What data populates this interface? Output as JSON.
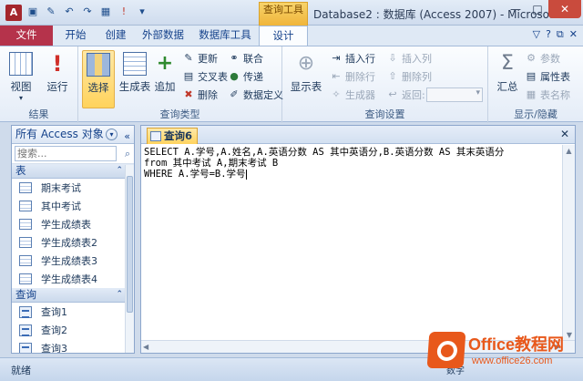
{
  "titlebar": {
    "app_icon_letter": "A",
    "qat_icons": [
      "save-icon",
      "edit-icon",
      "undo-icon",
      "redo-icon",
      "view-icon",
      "run-icon",
      "dropdown-icon"
    ],
    "context_group": "查询工具",
    "title": "Database2 : 数据库 (Access 2007) - Microsoft...",
    "controls": [
      "—",
      "□",
      "✕"
    ]
  },
  "tabs": {
    "file": "文件",
    "items": [
      "开始",
      "创建",
      "外部数据",
      "数据库工具"
    ],
    "active": "设计",
    "help_icons": [
      "▽",
      "?",
      "⧉",
      "✕"
    ]
  },
  "ribbon": {
    "results": {
      "label": "结果",
      "view": "视图",
      "run": "运行"
    },
    "query_type": {
      "label": "查询类型",
      "select": "选择",
      "make_table": "生成表",
      "append": "追加",
      "update": "更新",
      "crosstab": "交叉表",
      "delete": "删除",
      "union": "联合",
      "passthrough": "传递",
      "data_definition": "数据定义"
    },
    "query_setup": {
      "label": "查询设置",
      "show_table": "显示表",
      "insert_row": "插入行",
      "delete_row": "删除行",
      "builder": "生成器",
      "insert_col": "插入列",
      "delete_col": "删除列",
      "return": "返回:"
    },
    "show_hide": {
      "label": "显示/隐藏",
      "totals": "汇总",
      "parameters": "参数",
      "property_sheet": "属性表",
      "table_names": "表名称"
    }
  },
  "nav": {
    "title": "所有 Access 对象",
    "search_placeholder": "搜索...",
    "tables_header": "表",
    "tables": [
      "期末考试",
      "其中考试",
      "学生成绩表",
      "学生成绩表2",
      "学生成绩表3",
      "学生成绩表4"
    ],
    "queries_header": "查询",
    "queries": [
      "查询1",
      "查询2",
      "查询3"
    ]
  },
  "document": {
    "tab_label": "查询6",
    "sql_lines": [
      "SELECT A.学号,A.姓名,A.英语分数 AS 其中英语分,B.英语分数 AS 其末英语分",
      "from 其中考试 A,期末考试 B",
      "WHERE A.学号=B.学号"
    ]
  },
  "status": {
    "text": "就绪",
    "right": "数字"
  },
  "watermark": {
    "brand": "Office教程网",
    "url": "www.office26.com"
  }
}
